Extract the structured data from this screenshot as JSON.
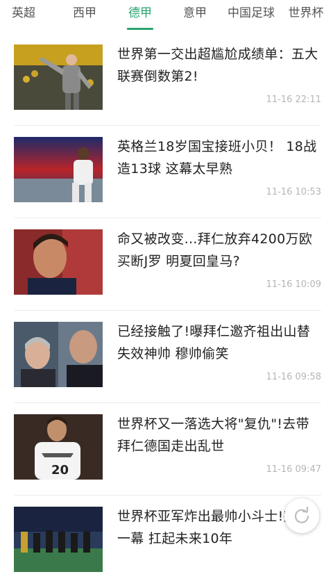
{
  "tabs": [
    {
      "label": "英超",
      "active": false
    },
    {
      "label": "西甲",
      "active": false
    },
    {
      "label": "德甲",
      "active": true
    },
    {
      "label": "意甲",
      "active": false
    },
    {
      "label": "中国足球",
      "active": false
    },
    {
      "label": "世界杯",
      "active": false
    }
  ],
  "accent_color": "#2aa36e",
  "news": [
    {
      "title": "世界第一交出超尴尬成绩单：五大联赛倒数第2!",
      "time": "11-16 22:11",
      "thumb": "goalkeeper-photo"
    },
    {
      "title": "英格兰18岁国宝接班小贝！ 18战造13球 这幕太早熟",
      "time": "11-16 10:53",
      "thumb": "young-player-photo"
    },
    {
      "title": "命又被改变…拜仁放弃4200万欧买断J罗 明夏回皇马?",
      "time": "11-16 10:09",
      "thumb": "james-rodriguez-photo"
    },
    {
      "title": "已经接触了!曝拜仁邀齐祖出山替失效神帅 穆帅偷笑",
      "time": "11-16 09:58",
      "thumb": "zidane-photo"
    },
    {
      "title": "世界杯又一落选大将\"复仇\"!去带拜仁德国走出乱世",
      "time": "11-16 09:47",
      "thumb": "germany-player-photo"
    },
    {
      "title": "世界杯亚军炸出最帅小斗士!完美一幕 扛起未来10年",
      "time": "",
      "thumb": "team-photo"
    }
  ],
  "refresh_icon": "refresh-icon"
}
